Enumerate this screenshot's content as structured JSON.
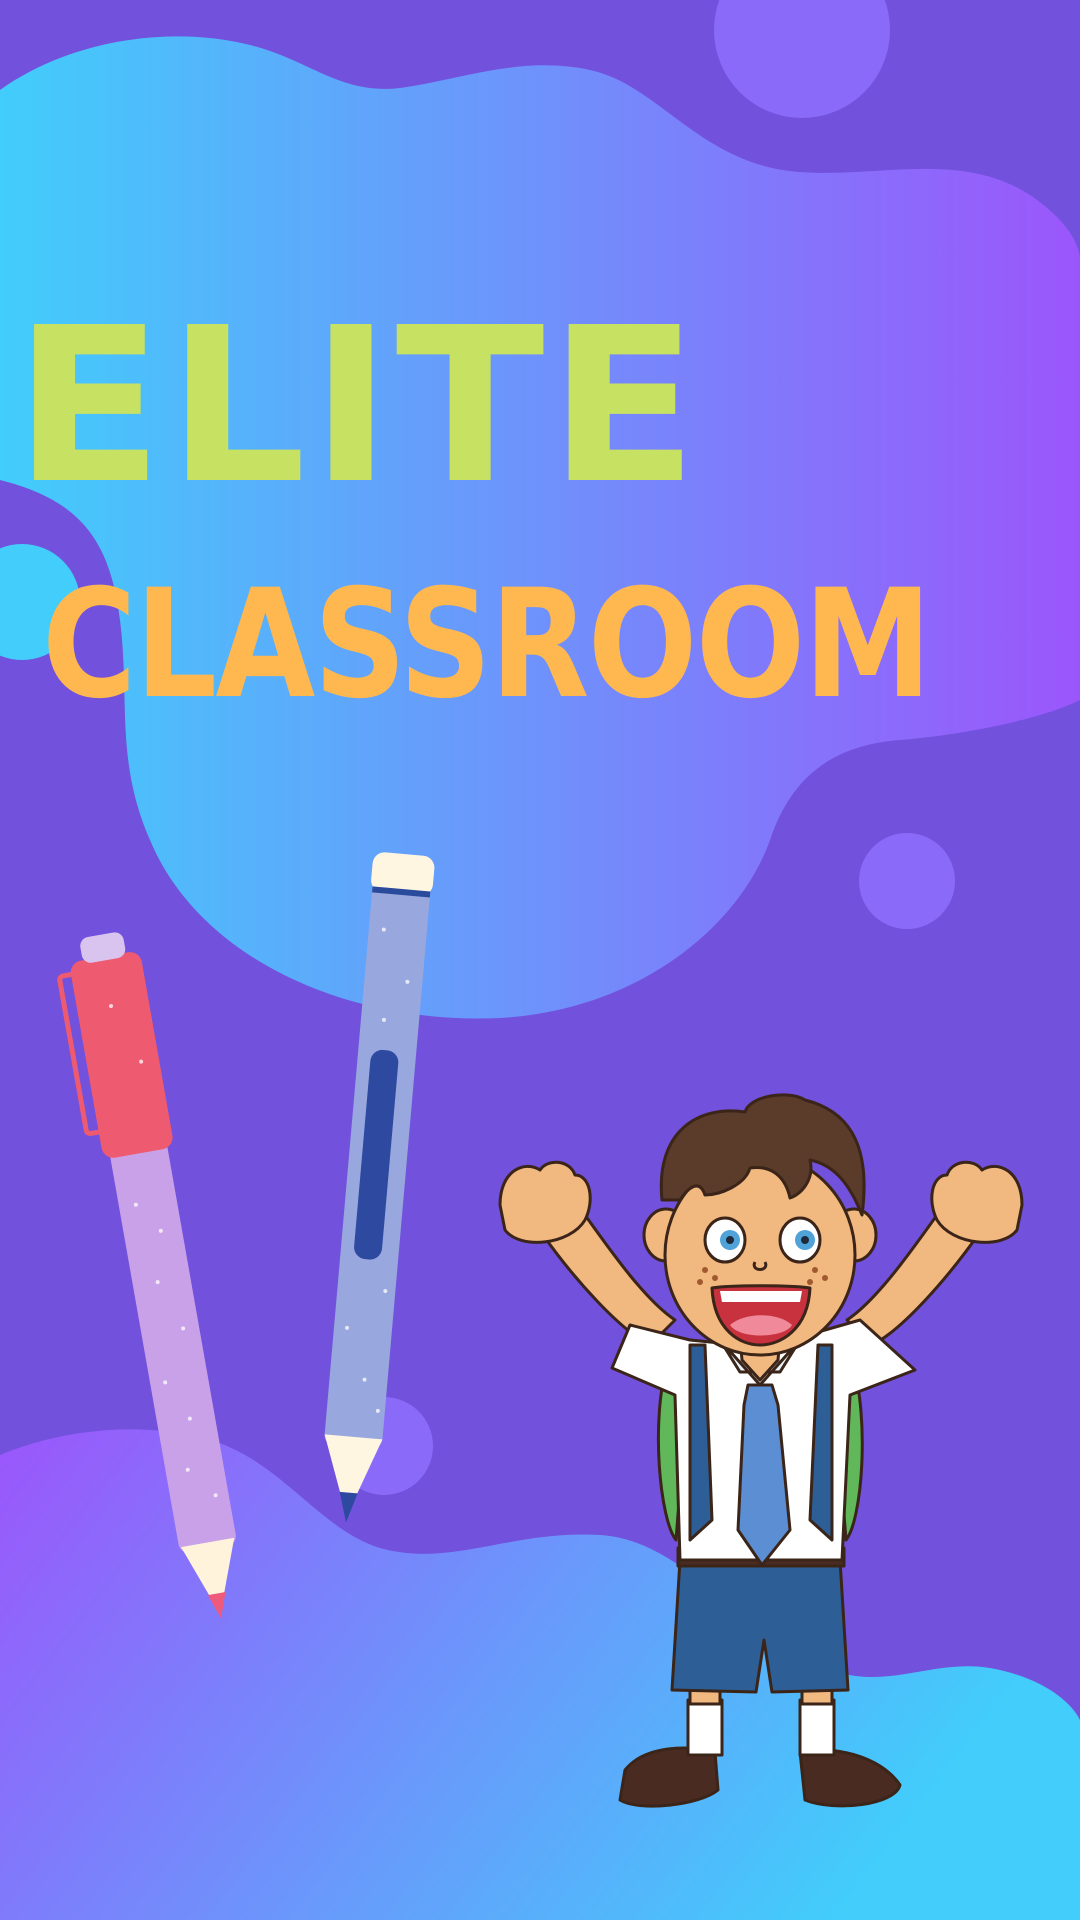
{
  "title": {
    "line1": "ELITE",
    "line2": "CLASSROOM"
  },
  "colors": {
    "background": "#7251dc",
    "blob_gradient_start": "#42cdfb",
    "blob_gradient_end": "#9b56fb",
    "title_line1": "#c7e163",
    "title_line2": "#ffb84f",
    "decor_circle": "#8a6bf9"
  },
  "illustrations": {
    "pen_left": "pink-pen",
    "pen_right": "blue-pen",
    "character": "cheering-schoolboy"
  }
}
